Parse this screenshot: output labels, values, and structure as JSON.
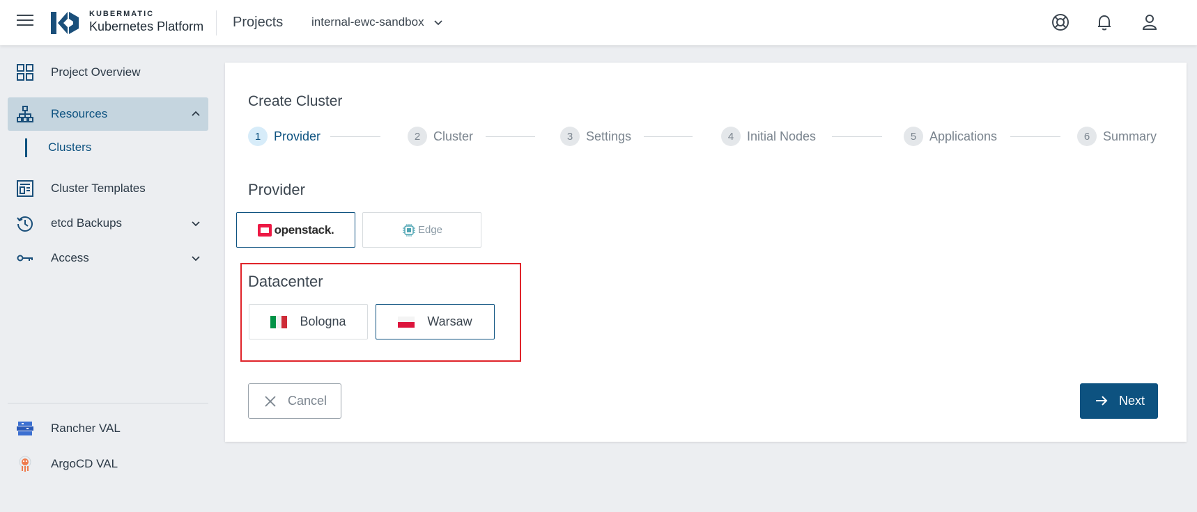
{
  "header": {
    "brand_top": "KUBERMATIC",
    "brand_bottom": "Kubernetes Platform",
    "section_title": "Projects",
    "project_selected": "internal-ewc-sandbox",
    "icons": [
      "menu-icon",
      "help-lifebuoy-icon",
      "bell-icon",
      "user-icon"
    ]
  },
  "sidebar": {
    "items": [
      {
        "label": "Project Overview",
        "icon": "grid-icon"
      },
      {
        "label": "Resources",
        "icon": "sitemap-icon",
        "expanded": true
      },
      {
        "label": "Clusters",
        "sub": true
      },
      {
        "label": "Cluster Templates",
        "icon": "template-icon"
      },
      {
        "label": "etcd Backups",
        "icon": "history-icon"
      },
      {
        "label": "Access",
        "icon": "key-icon"
      }
    ],
    "bottom_items": [
      {
        "label": "Rancher VAL",
        "icon": "rancher-icon"
      },
      {
        "label": "ArgoCD VAL",
        "icon": "argocd-icon"
      }
    ]
  },
  "main": {
    "title": "Create Cluster",
    "steps": [
      {
        "num": "1",
        "label": "Provider",
        "active": true
      },
      {
        "num": "2",
        "label": "Cluster"
      },
      {
        "num": "3",
        "label": "Settings"
      },
      {
        "num": "4",
        "label": "Initial Nodes"
      },
      {
        "num": "5",
        "label": "Applications"
      },
      {
        "num": "6",
        "label": "Summary"
      }
    ],
    "provider_label": "Provider",
    "providers": [
      {
        "label": "openstack.",
        "selected": true
      },
      {
        "label": "Edge",
        "selected": false
      }
    ],
    "datacenter_label": "Datacenter",
    "datacenters": [
      {
        "label": "Bologna",
        "flag": "italy-flag",
        "selected": false
      },
      {
        "label": "Warsaw",
        "flag": "poland-flag",
        "selected": true
      }
    ],
    "cancel_label": "Cancel",
    "next_label": "Next"
  },
  "colors": {
    "accent": "#0d5280",
    "highlight_box": "#e0242a",
    "active_nav_bg": "#c5d5df"
  }
}
